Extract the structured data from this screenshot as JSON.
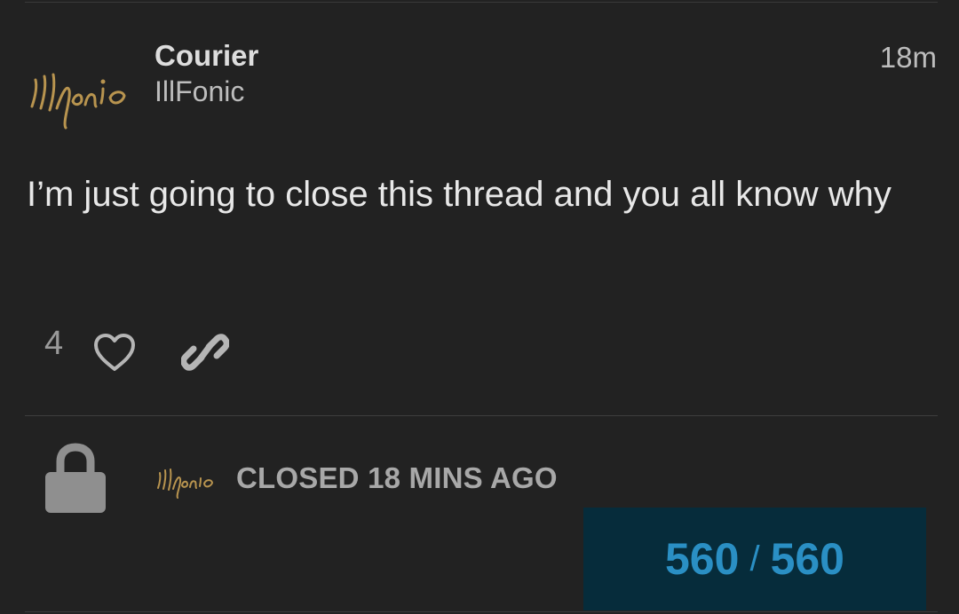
{
  "post": {
    "author_name": "Courier",
    "author_handle": "IllFonic",
    "time": "18m",
    "body": "I’m just going to close this thread and you all know why",
    "like_count": "4",
    "avatar_logo_text": "illfonic"
  },
  "status": {
    "closed_text": "CLOSED 18 MINS AGO"
  },
  "progress": {
    "current": "560",
    "separator": "/",
    "total": "560"
  },
  "icons": {
    "like": "heart-icon",
    "share": "link-icon",
    "closed": "lock-icon"
  },
  "colors": {
    "background": "#222222",
    "progress_bg": "#062c3b",
    "progress_text": "#2a8fc4",
    "lock": "#8f8f8f",
    "logo_gold": "#b8944f"
  }
}
